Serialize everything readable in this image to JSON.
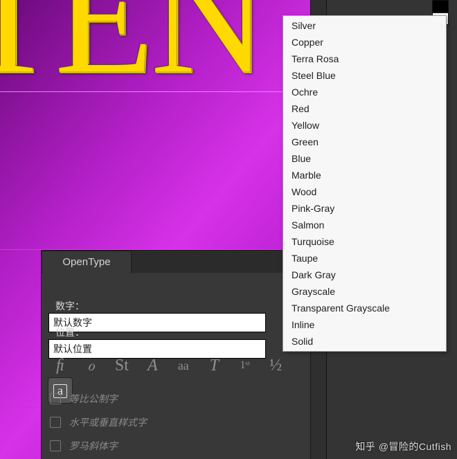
{
  "canvas": {
    "big_text": "TEN"
  },
  "panel": {
    "tab": "OpenType",
    "row_figure": {
      "label": "数字：",
      "value": "默认数字"
    },
    "row_position": {
      "label": "位置：",
      "value": "默认位置"
    },
    "icons": {
      "ligature": "ﬁ",
      "swash": "ℴ",
      "stylistic": "St",
      "titling": "A",
      "contextual": "aa",
      "smallcaps": "T",
      "ordinal": "1ˢᵗ",
      "fraction": "½",
      "boxed": "a"
    },
    "checks": {
      "tabular": "等比公制字",
      "hv_style": "水平或垂直样式字",
      "roman_italic": "罗马斜体字"
    }
  },
  "swatches": {
    "top": "#000000",
    "bottom": "#ffffff"
  },
  "dropdown": {
    "items": [
      "Silver",
      "Copper",
      "Terra Rosa",
      "Steel Blue",
      "Ochre",
      "Red",
      "Yellow",
      "Green",
      "Blue",
      "Marble",
      "Wood",
      "Pink-Gray",
      "Salmon",
      "Turquoise",
      "Taupe",
      "Dark Gray",
      "Grayscale",
      "Transparent Grayscale",
      "Inline",
      "Solid"
    ]
  },
  "watermark": "知乎 @冒险的Cutfish"
}
